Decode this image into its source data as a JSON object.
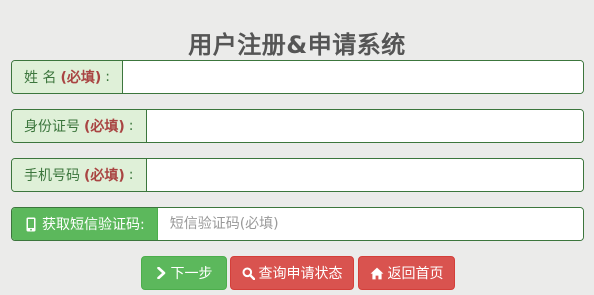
{
  "page": {
    "title": "用户注册&申请系统"
  },
  "form": {
    "name": {
      "label": "姓 名",
      "required": "(必填)",
      "colon": ":",
      "value": "",
      "placeholder": ""
    },
    "id_number": {
      "label": "身份证号",
      "required": "(必填)",
      "colon": ":",
      "value": "",
      "placeholder": ""
    },
    "phone": {
      "label": "手机号码",
      "required": "(必填)",
      "colon": ":",
      "value": "",
      "placeholder": ""
    },
    "sms_code": {
      "button_label": "获取短信验证码:",
      "value": "",
      "placeholder": "短信验证码(必填)"
    }
  },
  "actions": {
    "next_label": "下一步",
    "query_label": "查询申请状态",
    "home_label": "返回首页"
  },
  "colors": {
    "background": "#ebebea",
    "success": "#5cb85c",
    "danger": "#d9534f",
    "label_text": "#3c763d",
    "label_bg": "#dff0d8",
    "required_text": "#a94442"
  },
  "icons": {
    "sms": "mobile-phone-icon",
    "next": "chevron-right-icon",
    "query": "search-icon",
    "home": "home-icon"
  }
}
